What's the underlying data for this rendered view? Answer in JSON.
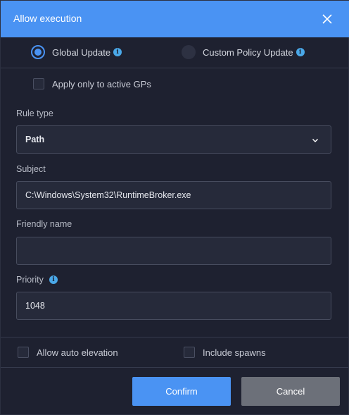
{
  "dialog": {
    "title": "Allow execution"
  },
  "scope": {
    "global_label": "Global Update",
    "custom_label": "Custom Policy Update",
    "selected": "global"
  },
  "active_gps": {
    "label": "Apply only to active GPs",
    "checked": false
  },
  "rule_type": {
    "label": "Rule type",
    "value": "Path"
  },
  "subject": {
    "label": "Subject",
    "value": "C:\\Windows\\System32\\RuntimeBroker.exe"
  },
  "friendly_name": {
    "label": "Friendly name",
    "value": ""
  },
  "priority": {
    "label": "Priority",
    "value": "1048"
  },
  "options": {
    "auto_elevation_label": "Allow auto elevation",
    "include_spawns_label": "Include spawns"
  },
  "buttons": {
    "confirm": "Confirm",
    "cancel": "Cancel"
  },
  "colors": {
    "accent": "#4a93f3",
    "background": "#1e2130",
    "info": "#4aa8e8"
  }
}
